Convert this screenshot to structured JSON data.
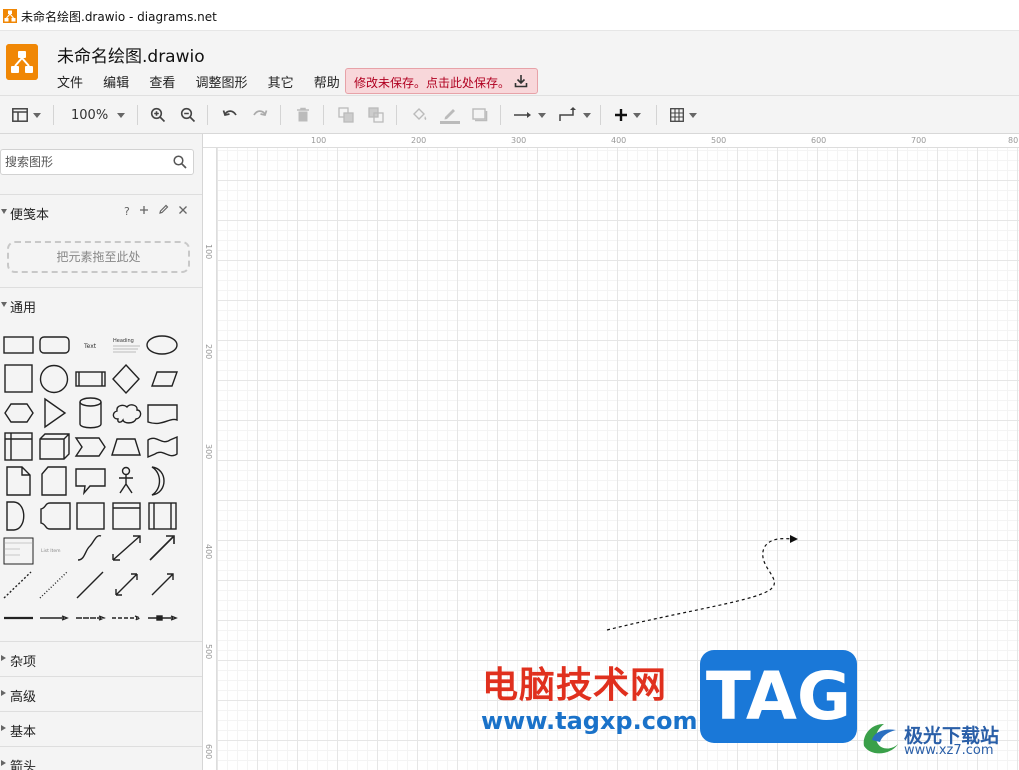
{
  "window": {
    "title": "未命名绘图.drawio - diagrams.net"
  },
  "header": {
    "doc_title": "未命名绘图.drawio",
    "menu": [
      "文件",
      "编辑",
      "查看",
      "调整图形",
      "其它",
      "帮助"
    ],
    "save_warning": "修改未保存。点击此处保存。"
  },
  "toolbar": {
    "zoom": "100%"
  },
  "sidebar": {
    "search_placeholder": "搜索图形",
    "scratchpad": {
      "title": "便笺本",
      "help": "?",
      "drop_hint": "把元素拖至此处"
    },
    "sections": [
      "通用",
      "杂项",
      "高级",
      "基本",
      "箭头"
    ],
    "shape_text_labels": {
      "text": "Text",
      "heading": "Heading",
      "list_item": "List Item"
    }
  },
  "rulers": {
    "horizontal": [
      "100",
      "200",
      "300",
      "400",
      "500",
      "600",
      "700",
      "80"
    ],
    "vertical": [
      "100",
      "200",
      "300",
      "400",
      "500",
      "600"
    ]
  },
  "watermark": {
    "cn": "电脑技术网",
    "url": "www.tagxp.com",
    "tag": "TAG",
    "site_cn": "极光下载站",
    "site_url": "www.xz7.com"
  },
  "colors": {
    "accent": "#f08705",
    "warning_bg": "#f8d7da",
    "warning_text": "#b00020",
    "watermark_red": "#e0301e",
    "watermark_blue": "#1a78d8"
  }
}
